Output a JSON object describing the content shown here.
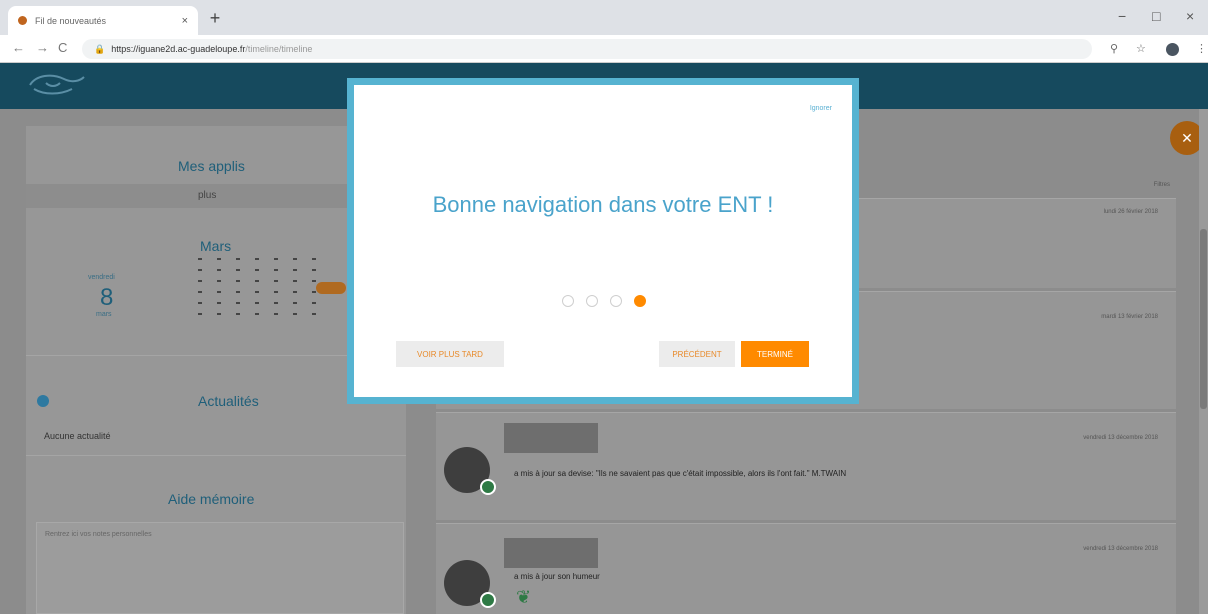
{
  "browser": {
    "tab_title": "Fil de nouveautés",
    "tab_close": "×",
    "new_tab": "+",
    "url_base": "https://iguane2d.ac-guadeloupe.fr",
    "url_path": "/timeline/timeline",
    "back": "←",
    "forward": "→",
    "reload": "C",
    "minimize": "−",
    "maximize": "□",
    "close": "×"
  },
  "left": {
    "apps_title": "Mes applis",
    "apps_more": "plus",
    "calendar_title": "Mars",
    "day_name": "vendredi",
    "day_number": "8",
    "day_month": "mars",
    "news_title": "Actualités",
    "news_empty": "Aucune actualité",
    "memo_title": "Aide mémoire",
    "memo_placeholder": "Rentrez ici vos notes personnelles"
  },
  "feed": {
    "items": [
      {
        "date": "lundi 26 février 2018"
      },
      {
        "date": "mardi 13 février 2018"
      },
      {
        "date": "vendredi 13 décembre 2018",
        "text": "a mis à jour sa devise: \"Ils ne savaient pas que c'était impossible, alors ils l'ont fait.\" M.TWAIN"
      },
      {
        "date": "vendredi 13 décembre 2018",
        "text": "a mis à jour son humeur"
      }
    ],
    "settings_label": "Filtres"
  },
  "modal": {
    "skip": "Ignorer",
    "title": "Bonne navigation dans votre ENT !",
    "later_button": "VOIR PLUS TARD",
    "prev_button": "PRÉCÉDENT",
    "done_button": "TERMINÉ",
    "steps": 4,
    "active_step": 4
  },
  "colors": {
    "accent_orange": "#ff8a00",
    "title_blue": "#4aa3cb",
    "header_blue": "#164a5e",
    "modal_border": "#56b3d1"
  }
}
